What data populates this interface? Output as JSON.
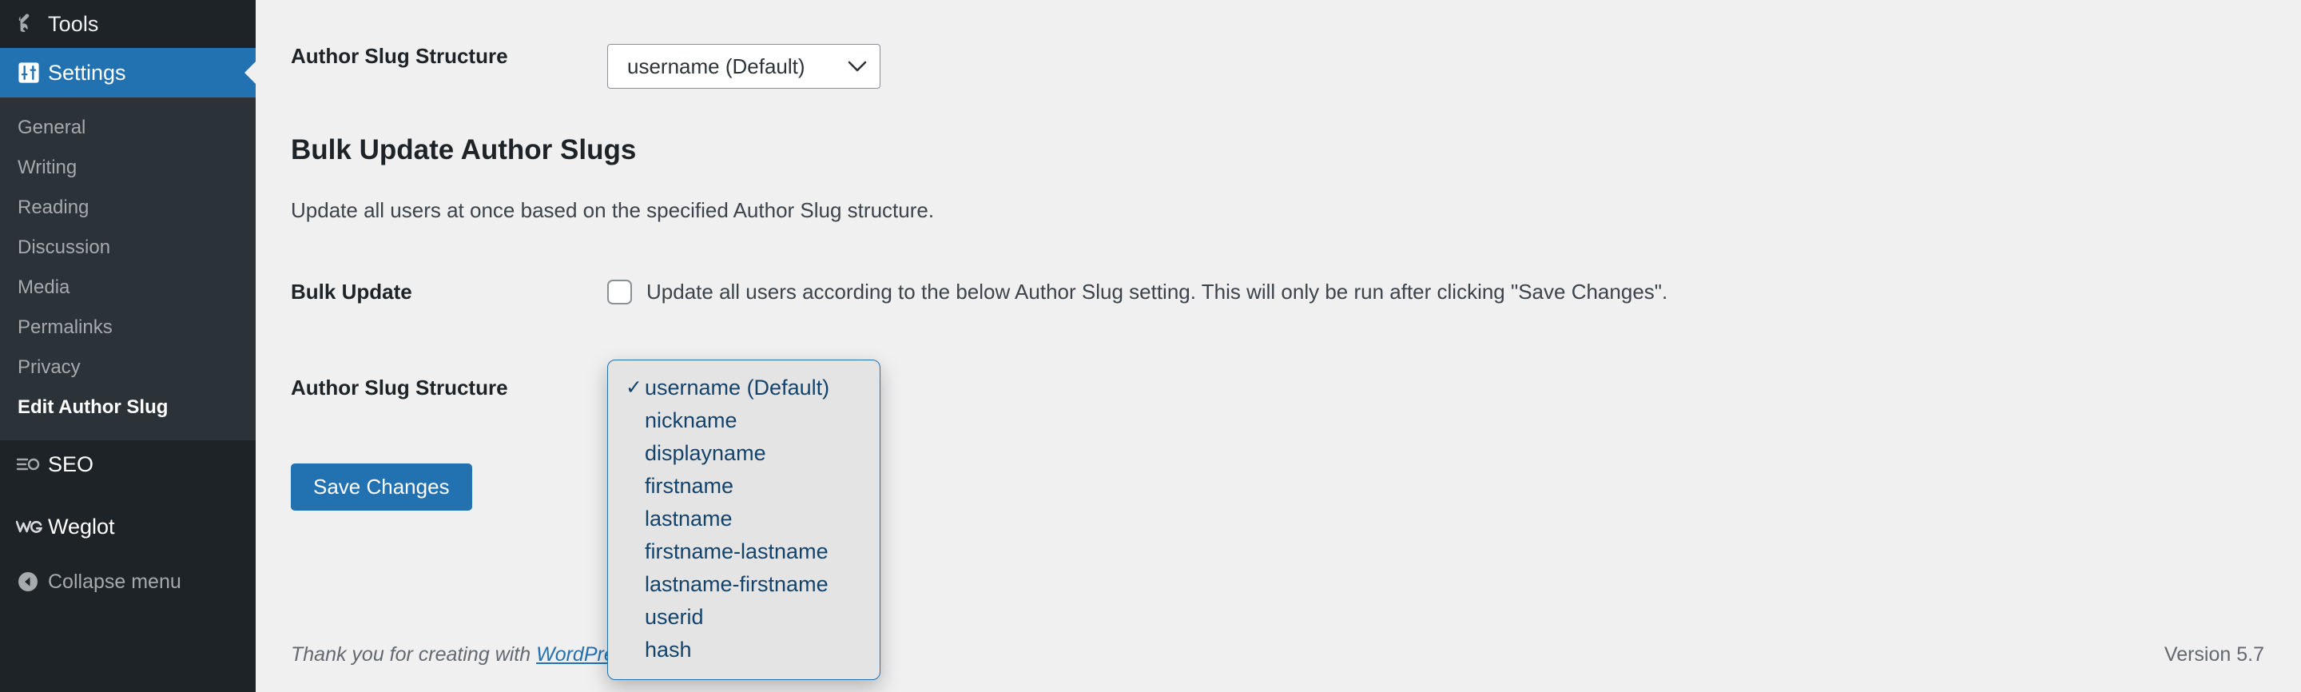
{
  "sidebar": {
    "top_item": {
      "label": "Tools",
      "icon": "wrench-icon"
    },
    "current_item": {
      "label": "Settings",
      "icon": "sliders-icon"
    },
    "submenu": [
      {
        "label": "General",
        "current": false
      },
      {
        "label": "Writing",
        "current": false
      },
      {
        "label": "Reading",
        "current": false
      },
      {
        "label": "Discussion",
        "current": false
      },
      {
        "label": "Media",
        "current": false
      },
      {
        "label": "Permalinks",
        "current": false
      },
      {
        "label": "Privacy",
        "current": false
      },
      {
        "label": "Edit Author Slug",
        "current": true
      }
    ],
    "plain_items": [
      {
        "label": "SEO",
        "icon": "seo-icon"
      },
      {
        "label": "Weglot",
        "icon": "weglot-icon"
      }
    ],
    "collapse": {
      "label": "Collapse menu",
      "icon": "collapse-arrow-icon"
    }
  },
  "main": {
    "top_field": {
      "label": "Author Slug Structure",
      "select_value": "username (Default)",
      "chevron": "˅"
    },
    "section": {
      "title": "Bulk Update Author Slugs",
      "description": "Update all users at once based on the specified Author Slug structure."
    },
    "bulk_update": {
      "label": "Bulk Update",
      "checkbox_label": "Update all users according to the below Author Slug setting. This will only be run after clicking \"Save Changes\".",
      "checked": false
    },
    "slug_field": {
      "label": "Author Slug Structure"
    },
    "dropdown": {
      "checkmark": "✓",
      "selected_index": 0,
      "options": [
        "username (Default)",
        "nickname",
        "displayname",
        "firstname",
        "lastname",
        "firstname-lastname",
        "lastname-firstname",
        "userid",
        "hash"
      ]
    },
    "save_button": "Save Changes"
  },
  "footer": {
    "thanks_prefix": "Thank you for creating with ",
    "wordpress_link": "WordPress",
    "thanks_suffix": ".",
    "version": "Version 5.7"
  },
  "colors": {
    "sidebar_bg": "#1d2327",
    "submenu_bg": "#2c3338",
    "accent": "#2271b1",
    "content_bg": "#f0f0f1",
    "dropdown_bg": "#e4e4e4",
    "dropdown_text": "#13436b"
  }
}
